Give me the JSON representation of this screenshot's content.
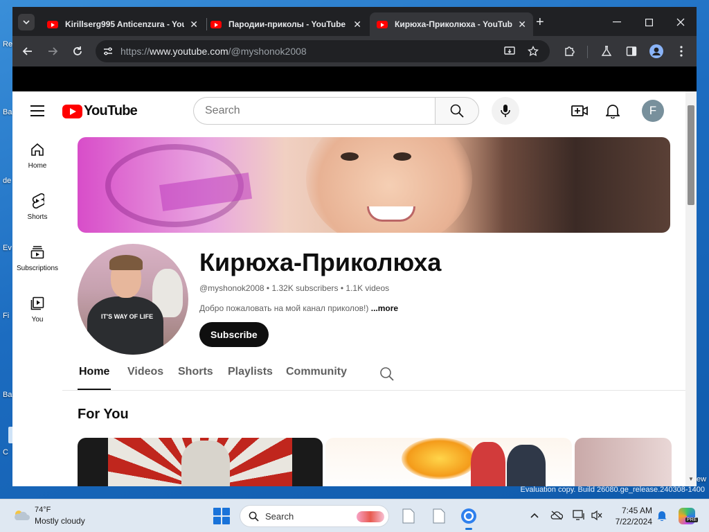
{
  "desktop": {
    "left_labels": [
      "Re",
      "Ba",
      "de",
      "Ev",
      "Fi",
      "Ba",
      "C"
    ],
    "right_label": "ew",
    "eval_text": "Evaluation copy. Build 26080.ge_release.240308-1400"
  },
  "browser": {
    "tabs": [
      {
        "title": "Kirillserg995 Anticenzura - You",
        "active": false
      },
      {
        "title": "Пародии-приколы - YouTube",
        "active": false
      },
      {
        "title": "Кирюха-Приколюха - YouTub",
        "active": true
      }
    ],
    "tab_close": "✕",
    "new_tab": "+",
    "url_scheme": "https://",
    "url_host": "www.youtube.com",
    "url_path": "/@myshonok2008"
  },
  "youtube": {
    "logo_text": "YouTube",
    "search_placeholder": "Search",
    "user_initial": "F",
    "guide": [
      {
        "label": "Home",
        "icon": "home-icon"
      },
      {
        "label": "Shorts",
        "icon": "shorts-icon"
      },
      {
        "label": "Subscriptions",
        "icon": "subscriptions-icon"
      },
      {
        "label": "You",
        "icon": "you-icon"
      }
    ],
    "channel": {
      "name": "Кирюха-Приколюха",
      "handle": "@myshonok2008",
      "subscribers": "1.32K subscribers",
      "videos": "1.1K videos",
      "separator": "•",
      "description": "Добро пожаловать на мой канал приколов!)",
      "more": "...more",
      "subscribe": "Subscribe",
      "avatar_shirt_text": "IT'S WAY OF LIFE"
    },
    "tabs": [
      "Home",
      "Videos",
      "Shorts",
      "Playlists",
      "Community"
    ],
    "active_tab": "Home",
    "section_title": "For You"
  },
  "taskbar": {
    "temperature": "74°F",
    "condition": "Mostly cloudy",
    "search_label": "Search",
    "time": "7:45 AM",
    "date": "7/22/2024",
    "copilot_badge": "PRE"
  },
  "colors": {
    "youtube_red": "#ff0000",
    "chrome_dark": "#202124",
    "chrome_toolbar": "#35363a",
    "desktop_blue": "#1c6cc0",
    "subscribe_bg": "#0f0f0f"
  }
}
